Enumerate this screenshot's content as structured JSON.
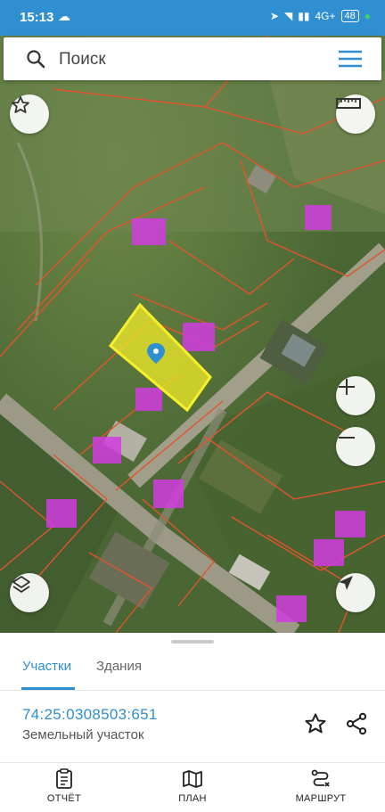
{
  "status": {
    "time": "15:13",
    "network": "4G+",
    "battery": "48"
  },
  "search": {
    "placeholder": "Поиск"
  },
  "sheet": {
    "tabs": [
      {
        "label": "Участки",
        "active": true
      },
      {
        "label": "Здания",
        "active": false
      }
    ],
    "parcel": {
      "cadastral_number": "74:25:0308503:651",
      "type": "Земельный участок"
    }
  },
  "nav": [
    {
      "label": "ОТЧЁТ",
      "icon": "clipboard-icon"
    },
    {
      "label": "ПЛАН",
      "icon": "map-icon"
    },
    {
      "label": "МАРШРУТ",
      "icon": "route-icon"
    }
  ],
  "colors": {
    "accent": "#2f8fd0",
    "parcel_highlight": "#f2ec28",
    "building": "#d23ce0",
    "boundary": "#e0552d"
  }
}
